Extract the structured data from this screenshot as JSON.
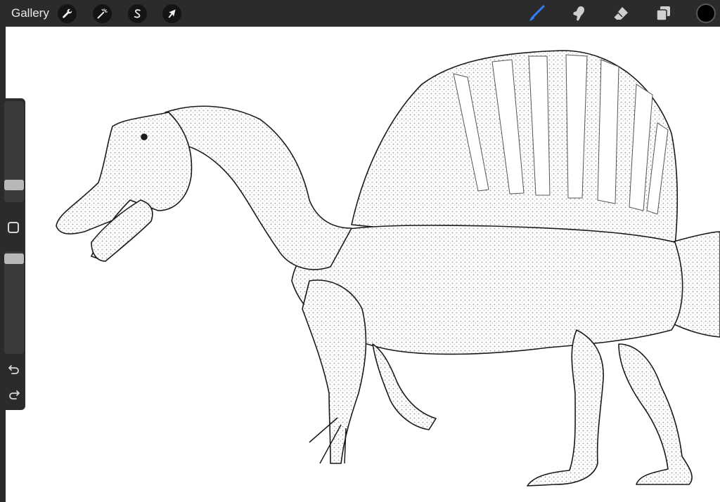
{
  "toolbar": {
    "gallery_label": "Gallery",
    "left_tools": [
      "actions-wrench",
      "adjustments-magic-wand",
      "selection-s",
      "transform-arrow"
    ],
    "right_tools": [
      "brush",
      "smudge",
      "eraser",
      "layers"
    ],
    "active_tool": "brush",
    "active_tool_color": "#2f7cf6",
    "current_color": "#000000"
  },
  "sidebar": {
    "brush_size_level": 0.13,
    "opacity_level": 0.98,
    "buttons": [
      "modify",
      "undo",
      "redo"
    ]
  },
  "canvas": {
    "background": "#ffffff",
    "subject": "spinosaurus-drawing"
  }
}
